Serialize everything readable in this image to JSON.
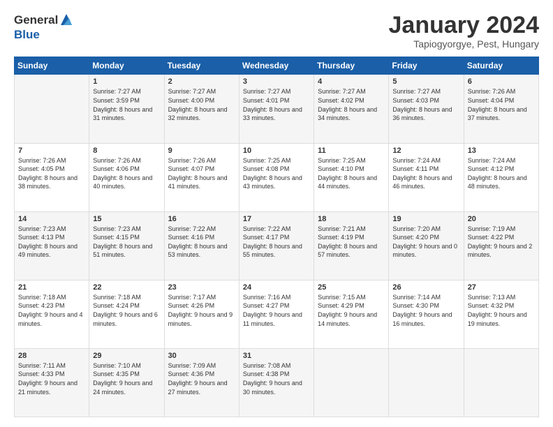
{
  "logo": {
    "general": "General",
    "blue": "Blue"
  },
  "title": "January 2024",
  "subtitle": "Tapiogyorgye, Pest, Hungary",
  "headers": [
    "Sunday",
    "Monday",
    "Tuesday",
    "Wednesday",
    "Thursday",
    "Friday",
    "Saturday"
  ],
  "rows": [
    [
      {
        "day": "",
        "sunrise": "",
        "sunset": "",
        "daylight": ""
      },
      {
        "day": "1",
        "sunrise": "Sunrise: 7:27 AM",
        "sunset": "Sunset: 3:59 PM",
        "daylight": "Daylight: 8 hours and 31 minutes."
      },
      {
        "day": "2",
        "sunrise": "Sunrise: 7:27 AM",
        "sunset": "Sunset: 4:00 PM",
        "daylight": "Daylight: 8 hours and 32 minutes."
      },
      {
        "day": "3",
        "sunrise": "Sunrise: 7:27 AM",
        "sunset": "Sunset: 4:01 PM",
        "daylight": "Daylight: 8 hours and 33 minutes."
      },
      {
        "day": "4",
        "sunrise": "Sunrise: 7:27 AM",
        "sunset": "Sunset: 4:02 PM",
        "daylight": "Daylight: 8 hours and 34 minutes."
      },
      {
        "day": "5",
        "sunrise": "Sunrise: 7:27 AM",
        "sunset": "Sunset: 4:03 PM",
        "daylight": "Daylight: 8 hours and 36 minutes."
      },
      {
        "day": "6",
        "sunrise": "Sunrise: 7:26 AM",
        "sunset": "Sunset: 4:04 PM",
        "daylight": "Daylight: 8 hours and 37 minutes."
      }
    ],
    [
      {
        "day": "7",
        "sunrise": "Sunrise: 7:26 AM",
        "sunset": "Sunset: 4:05 PM",
        "daylight": "Daylight: 8 hours and 38 minutes."
      },
      {
        "day": "8",
        "sunrise": "Sunrise: 7:26 AM",
        "sunset": "Sunset: 4:06 PM",
        "daylight": "Daylight: 8 hours and 40 minutes."
      },
      {
        "day": "9",
        "sunrise": "Sunrise: 7:26 AM",
        "sunset": "Sunset: 4:07 PM",
        "daylight": "Daylight: 8 hours and 41 minutes."
      },
      {
        "day": "10",
        "sunrise": "Sunrise: 7:25 AM",
        "sunset": "Sunset: 4:08 PM",
        "daylight": "Daylight: 8 hours and 43 minutes."
      },
      {
        "day": "11",
        "sunrise": "Sunrise: 7:25 AM",
        "sunset": "Sunset: 4:10 PM",
        "daylight": "Daylight: 8 hours and 44 minutes."
      },
      {
        "day": "12",
        "sunrise": "Sunrise: 7:24 AM",
        "sunset": "Sunset: 4:11 PM",
        "daylight": "Daylight: 8 hours and 46 minutes."
      },
      {
        "day": "13",
        "sunrise": "Sunrise: 7:24 AM",
        "sunset": "Sunset: 4:12 PM",
        "daylight": "Daylight: 8 hours and 48 minutes."
      }
    ],
    [
      {
        "day": "14",
        "sunrise": "Sunrise: 7:23 AM",
        "sunset": "Sunset: 4:13 PM",
        "daylight": "Daylight: 8 hours and 49 minutes."
      },
      {
        "day": "15",
        "sunrise": "Sunrise: 7:23 AM",
        "sunset": "Sunset: 4:15 PM",
        "daylight": "Daylight: 8 hours and 51 minutes."
      },
      {
        "day": "16",
        "sunrise": "Sunrise: 7:22 AM",
        "sunset": "Sunset: 4:16 PM",
        "daylight": "Daylight: 8 hours and 53 minutes."
      },
      {
        "day": "17",
        "sunrise": "Sunrise: 7:22 AM",
        "sunset": "Sunset: 4:17 PM",
        "daylight": "Daylight: 8 hours and 55 minutes."
      },
      {
        "day": "18",
        "sunrise": "Sunrise: 7:21 AM",
        "sunset": "Sunset: 4:19 PM",
        "daylight": "Daylight: 8 hours and 57 minutes."
      },
      {
        "day": "19",
        "sunrise": "Sunrise: 7:20 AM",
        "sunset": "Sunset: 4:20 PM",
        "daylight": "Daylight: 9 hours and 0 minutes."
      },
      {
        "day": "20",
        "sunrise": "Sunrise: 7:19 AM",
        "sunset": "Sunset: 4:22 PM",
        "daylight": "Daylight: 9 hours and 2 minutes."
      }
    ],
    [
      {
        "day": "21",
        "sunrise": "Sunrise: 7:18 AM",
        "sunset": "Sunset: 4:23 PM",
        "daylight": "Daylight: 9 hours and 4 minutes."
      },
      {
        "day": "22",
        "sunrise": "Sunrise: 7:18 AM",
        "sunset": "Sunset: 4:24 PM",
        "daylight": "Daylight: 9 hours and 6 minutes."
      },
      {
        "day": "23",
        "sunrise": "Sunrise: 7:17 AM",
        "sunset": "Sunset: 4:26 PM",
        "daylight": "Daylight: 9 hours and 9 minutes."
      },
      {
        "day": "24",
        "sunrise": "Sunrise: 7:16 AM",
        "sunset": "Sunset: 4:27 PM",
        "daylight": "Daylight: 9 hours and 11 minutes."
      },
      {
        "day": "25",
        "sunrise": "Sunrise: 7:15 AM",
        "sunset": "Sunset: 4:29 PM",
        "daylight": "Daylight: 9 hours and 14 minutes."
      },
      {
        "day": "26",
        "sunrise": "Sunrise: 7:14 AM",
        "sunset": "Sunset: 4:30 PM",
        "daylight": "Daylight: 9 hours and 16 minutes."
      },
      {
        "day": "27",
        "sunrise": "Sunrise: 7:13 AM",
        "sunset": "Sunset: 4:32 PM",
        "daylight": "Daylight: 9 hours and 19 minutes."
      }
    ],
    [
      {
        "day": "28",
        "sunrise": "Sunrise: 7:11 AM",
        "sunset": "Sunset: 4:33 PM",
        "daylight": "Daylight: 9 hours and 21 minutes."
      },
      {
        "day": "29",
        "sunrise": "Sunrise: 7:10 AM",
        "sunset": "Sunset: 4:35 PM",
        "daylight": "Daylight: 9 hours and 24 minutes."
      },
      {
        "day": "30",
        "sunrise": "Sunrise: 7:09 AM",
        "sunset": "Sunset: 4:36 PM",
        "daylight": "Daylight: 9 hours and 27 minutes."
      },
      {
        "day": "31",
        "sunrise": "Sunrise: 7:08 AM",
        "sunset": "Sunset: 4:38 PM",
        "daylight": "Daylight: 9 hours and 30 minutes."
      },
      {
        "day": "",
        "sunrise": "",
        "sunset": "",
        "daylight": ""
      },
      {
        "day": "",
        "sunrise": "",
        "sunset": "",
        "daylight": ""
      },
      {
        "day": "",
        "sunrise": "",
        "sunset": "",
        "daylight": ""
      }
    ]
  ]
}
